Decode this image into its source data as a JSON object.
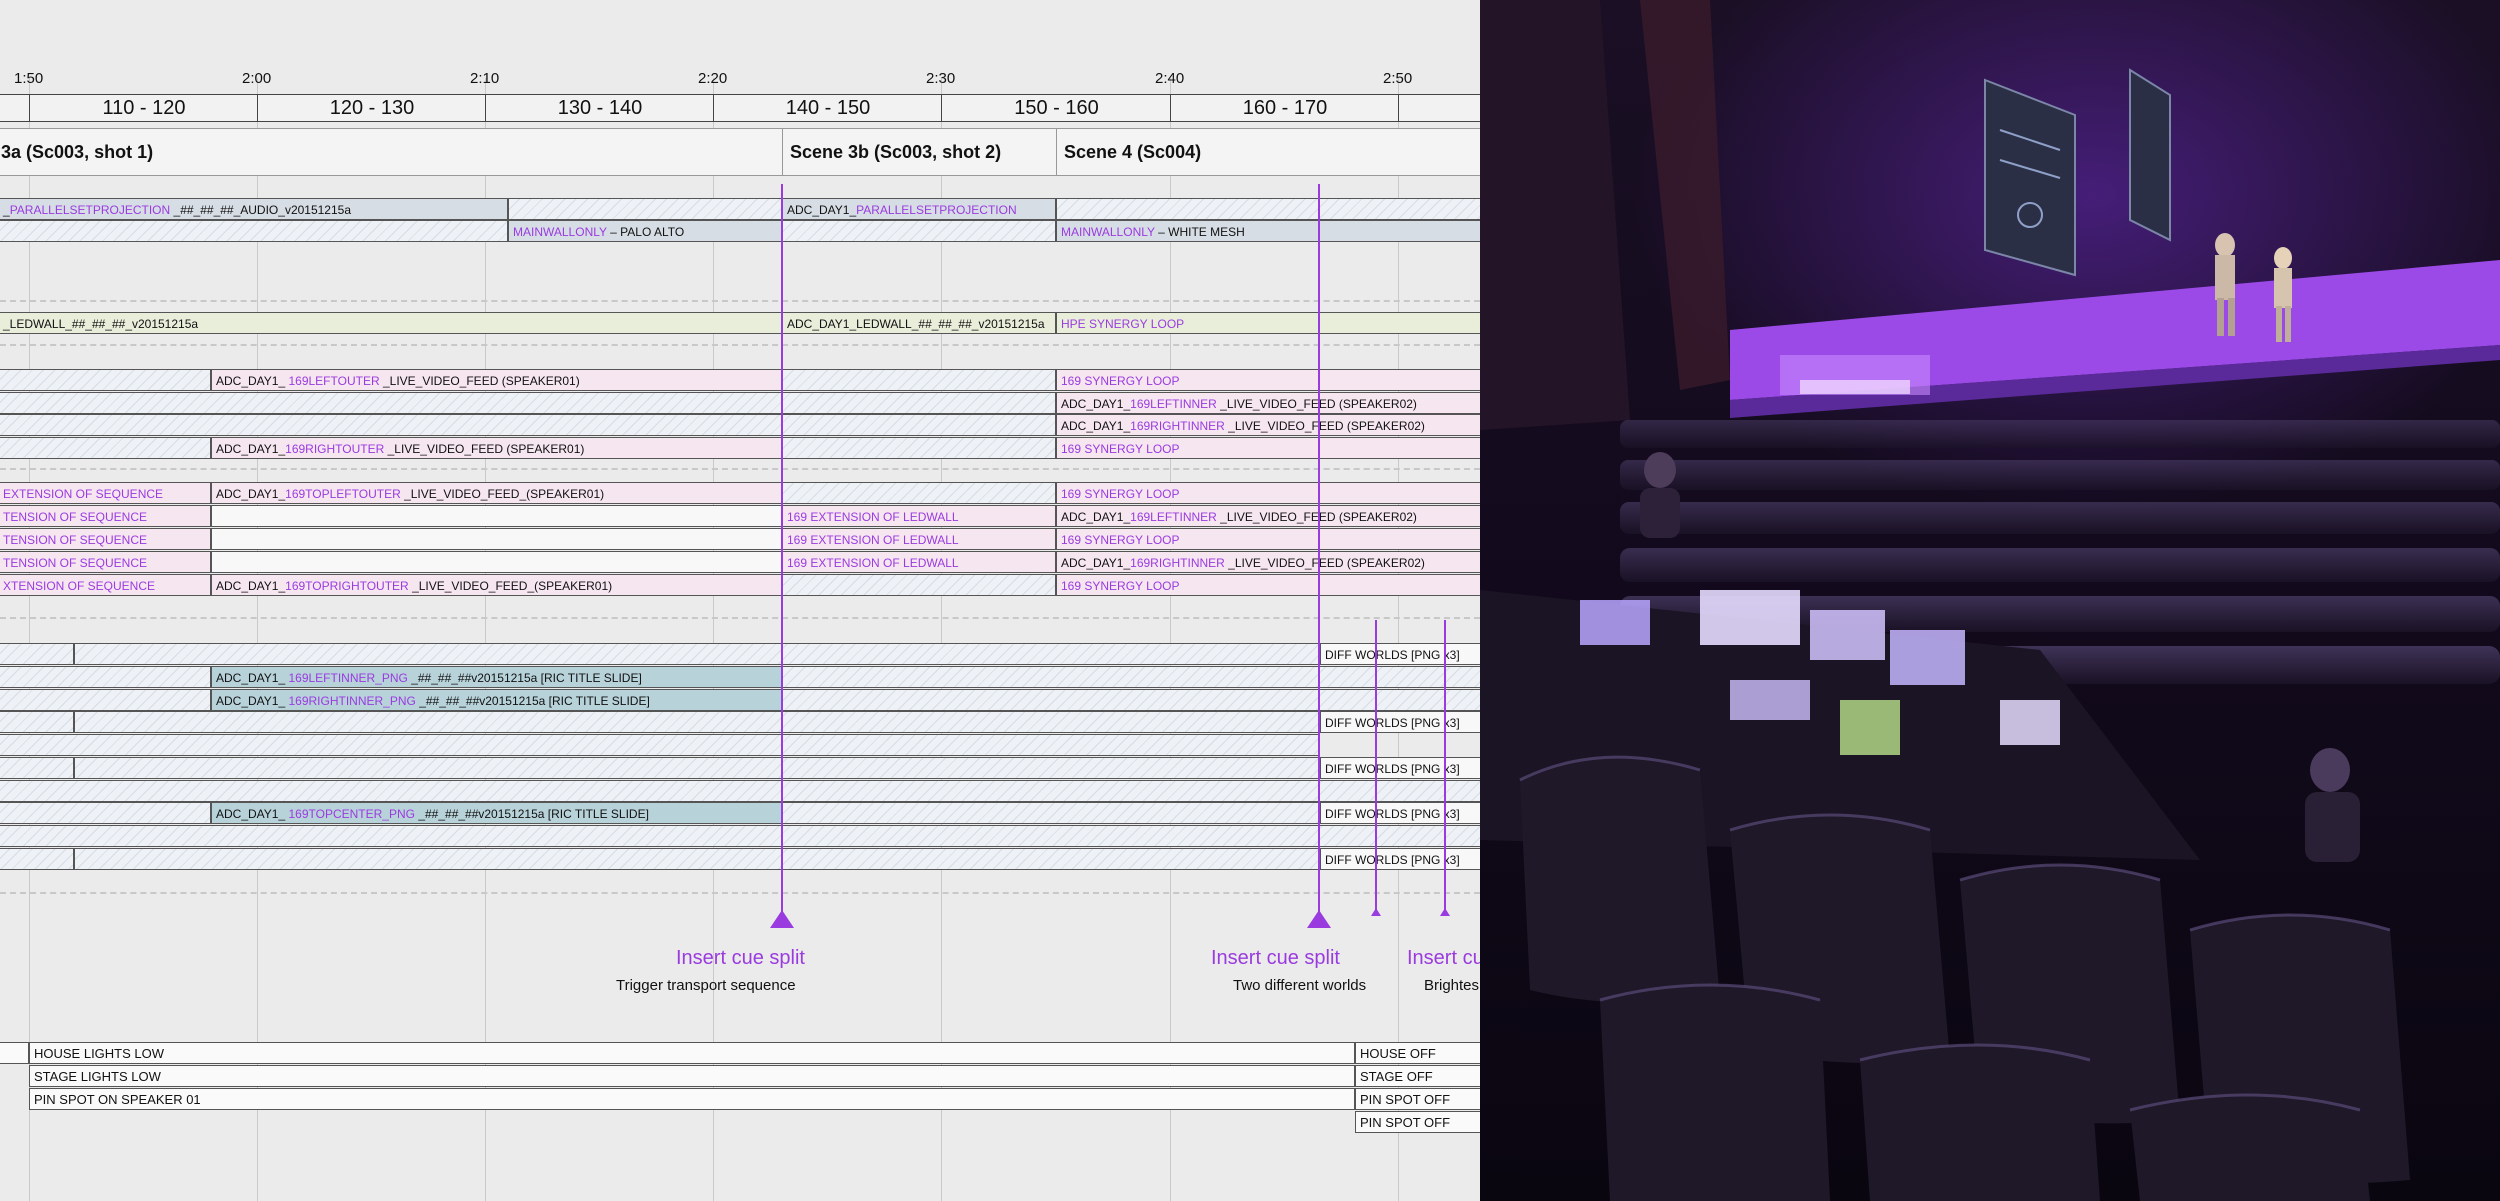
{
  "timeline": {
    "ticks": [
      "1:50",
      "2:00",
      "2:10",
      "2:20",
      "2:30",
      "2:40",
      "2:50"
    ],
    "ranges": [
      "110 - 120",
      "120 - 130",
      "130 - 140",
      "140 - 150",
      "150 - 160",
      "160 - 170"
    ],
    "scenes": [
      "3a (Sc003, shot 1)",
      "Scene 3b (Sc003, shot 2)",
      "Scene 4 (Sc004)"
    ]
  },
  "clips": [
    {
      "style": "gray",
      "pre": "_",
      "hl": "PARALLELSETPROJECTION",
      "post": " _##_##_##_AUDIO_v20151215a"
    },
    {
      "style": "gray",
      "pre": "ADC_DAY1_",
      "hl": "PARALLELSETPROJECTION",
      "post": ""
    },
    {
      "style": "gray",
      "pre": "",
      "hl": "MAINWALLONLY",
      "post": " – PALO ALTO"
    },
    {
      "style": "gray",
      "pre": "",
      "hl": "MAINWALLONLY",
      "post": " – WHITE MESH"
    },
    {
      "style": "green",
      "pre": "_LEDWALL_##_##_##_v20151215a",
      "hl": "",
      "post": ""
    },
    {
      "style": "green",
      "pre": "ADC_DAY1_LEDWALL_##_##_##_v20151215a",
      "hl": "",
      "post": ""
    },
    {
      "style": "green",
      "pre": "",
      "hl": "HPE SYNERGY LOOP",
      "post": ""
    },
    {
      "style": "pink",
      "pre": "ADC_DAY1_ ",
      "hl": "169LEFTOUTER",
      "post": " _LIVE_VIDEO_FEED (SPEAKER01)"
    },
    {
      "style": "pink",
      "pre": "",
      "hl": "169 SYNERGY LOOP",
      "post": ""
    },
    {
      "style": "pink",
      "pre": "ADC_DAY1_",
      "hl": "169LEFTINNER",
      "post": " _LIVE_VIDEO_FEED (SPEAKER02)"
    },
    {
      "style": "pink",
      "pre": "ADC_DAY1_",
      "hl": "169RIGHTINNER",
      "post": " _LIVE_VIDEO_FEED (SPEAKER02)"
    },
    {
      "style": "pink",
      "pre": "ADC_DAY1_",
      "hl": "169RIGHTOUTER",
      "post": " _LIVE_VIDEO_FEED (SPEAKER01)"
    },
    {
      "style": "pink",
      "pre": "",
      "hl": "169 SYNERGY LOOP",
      "post": ""
    },
    {
      "style": "pink",
      "pre": "",
      "hl": "EXTENSION OF SEQUENCE",
      "post": ""
    },
    {
      "style": "pink",
      "pre": "ADC_DAY1_",
      "hl": "169TOPLEFTOUTER",
      "post": "  _LIVE_VIDEO_FEED_(SPEAKER01)"
    },
    {
      "style": "pink",
      "pre": "",
      "hl": "169 SYNERGY LOOP",
      "post": ""
    },
    {
      "style": "pink",
      "pre": "",
      "hl": "TENSION OF SEQUENCE",
      "post": ""
    },
    {
      "style": "pink",
      "pre": "",
      "hl": "169 EXTENSION OF LEDWALL",
      "post": ""
    },
    {
      "style": "pink",
      "pre": "ADC_DAY1_",
      "hl": "169LEFTINNER",
      "post": " _LIVE_VIDEO_FEED (SPEAKER02)"
    },
    {
      "style": "pink",
      "pre": "",
      "hl": "TENSION OF SEQUENCE",
      "post": ""
    },
    {
      "style": "pink",
      "pre": "",
      "hl": "169 EXTENSION OF LEDWALL",
      "post": ""
    },
    {
      "style": "pink",
      "pre": "",
      "hl": "169 SYNERGY LOOP",
      "post": ""
    },
    {
      "style": "pink",
      "pre": "",
      "hl": "TENSION OF SEQUENCE",
      "post": ""
    },
    {
      "style": "pink",
      "pre": "",
      "hl": "169 EXTENSION OF LEDWALL",
      "post": ""
    },
    {
      "style": "pink",
      "pre": "ADC_DAY1_",
      "hl": "169RIGHTINNER",
      "post": " _LIVE_VIDEO_FEED (SPEAKER02)"
    },
    {
      "style": "pink",
      "pre": "",
      "hl": "XTENSION OF SEQUENCE",
      "post": ""
    },
    {
      "style": "pink",
      "pre": "ADC_DAY1_",
      "hl": "169TOPRIGHTOUTER",
      "post": " _LIVE_VIDEO_FEED_(SPEAKER01)"
    },
    {
      "style": "pink",
      "pre": "",
      "hl": "169 SYNERGY LOOP",
      "post": ""
    },
    {
      "style": "white",
      "pre": "DIFF WORLDS [PNG x3]",
      "hl": "",
      "post": ""
    },
    {
      "style": "teal",
      "pre": "ADC_DAY1_ ",
      "hl": "169LEFTINNER_PNG",
      "post": " _##_##_##v20151215a [RIC TITLE SLIDE]"
    },
    {
      "style": "teal",
      "pre": "ADC_DAY1_ ",
      "hl": "169RIGHTINNER_PNG",
      "post": " _##_##_##v20151215a [RIC TITLE SLIDE]"
    },
    {
      "style": "white",
      "pre": "DIFF WORLDS [PNG x3]",
      "hl": "",
      "post": ""
    },
    {
      "style": "white",
      "pre": "DIFF WORLDS [PNG x3]",
      "hl": "",
      "post": ""
    },
    {
      "style": "teal",
      "pre": "ADC_DAY1_ ",
      "hl": "169TOPCENTER_PNG",
      "post": " _##_##_##v20151215a [RIC TITLE SLIDE]"
    },
    {
      "style": "white",
      "pre": "DIFF WORLDS [PNG x3]",
      "hl": "",
      "post": ""
    },
    {
      "style": "white",
      "pre": "DIFF WORLDS [PNG x3]",
      "hl": "",
      "post": ""
    }
  ],
  "cues": [
    {
      "title": "Insert cue split",
      "desc": "Trigger transport sequence"
    },
    {
      "title": "Insert cue split",
      "desc": "Two different worlds"
    },
    {
      "title": "Insert cu",
      "desc": "Brightes"
    }
  ],
  "lighting": [
    "HOUSE LIGHTS LOW",
    "STAGE LIGHTS LOW",
    "PIN SPOT ON SPEAKER 01",
    "HOUSE OFF",
    "STAGE OFF",
    "PIN SPOT OFF",
    "PIN SPOT OFF"
  ],
  "colors": {
    "accent": "#9a3be0",
    "clip_gray": "#d7dde4",
    "clip_green": "#e9eedb",
    "clip_pink": "#f6e6f0",
    "clip_teal": "#b8d2da"
  },
  "photo": {
    "subject": "concert-hall-photo"
  }
}
